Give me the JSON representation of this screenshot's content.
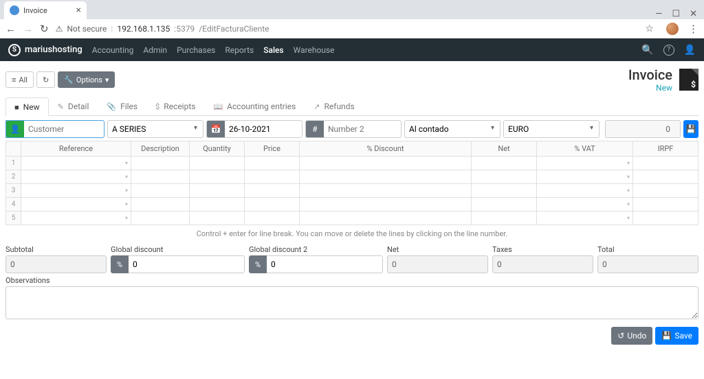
{
  "browser": {
    "tab_title": "Invoice",
    "not_secure": "Not secure",
    "url_host": "192.168.1.135",
    "url_port": ":5379",
    "url_path": "/EditFacturaCliente"
  },
  "brand": "mariushosting",
  "nav": [
    "Accounting",
    "Admin",
    "Purchases",
    "Reports",
    "Sales",
    "Warehouse"
  ],
  "nav_active": "Sales",
  "toolbar": {
    "all": "All",
    "options": "Options"
  },
  "page": {
    "title": "Invoice",
    "status": "New"
  },
  "tabs": [
    {
      "icon": "file-icon",
      "label": "New",
      "active": true
    },
    {
      "icon": "pencil-icon",
      "label": "Detail"
    },
    {
      "icon": "paperclip-icon",
      "label": "Files"
    },
    {
      "icon": "dollar-icon",
      "label": "Receipts"
    },
    {
      "icon": "book-icon",
      "label": "Accounting entries"
    },
    {
      "icon": "share-icon",
      "label": "Refunds"
    }
  ],
  "form": {
    "customer_placeholder": "Customer",
    "series": "A SERIES",
    "date": "26-10-2021",
    "number_placeholder": "Number 2",
    "payment": "Al contado",
    "currency": "EURO",
    "counter": "0"
  },
  "table": {
    "headers": [
      "Reference",
      "Description",
      "Quantity",
      "Price",
      "% Discount",
      "Net",
      "% VAT",
      "IRPF"
    ],
    "rows": 5
  },
  "hint": "Control + enter for line break. You can move or delete the lines by clicking on the line number.",
  "totals": {
    "subtotal_label": "Subtotal",
    "subtotal_value": "0",
    "gd1_label": "Global discount",
    "gd1_value": "0",
    "gd2_label": "Global discount 2",
    "gd2_value": "0",
    "net_label": "Net",
    "net_value": "0",
    "taxes_label": "Taxes",
    "taxes_value": "0",
    "total_label": "Total",
    "total_value": "0"
  },
  "observations_label": "Observations",
  "footer": {
    "undo": "Undo",
    "save": "Save"
  },
  "icons": {
    "person": "👤",
    "calendar": "📅",
    "hash": "#",
    "percent": "%",
    "save": "💾",
    "undo": "↺",
    "search": "🔍",
    "help": "?",
    "user": "👤",
    "list": "≡",
    "refresh": "↻",
    "caret": "▾"
  }
}
